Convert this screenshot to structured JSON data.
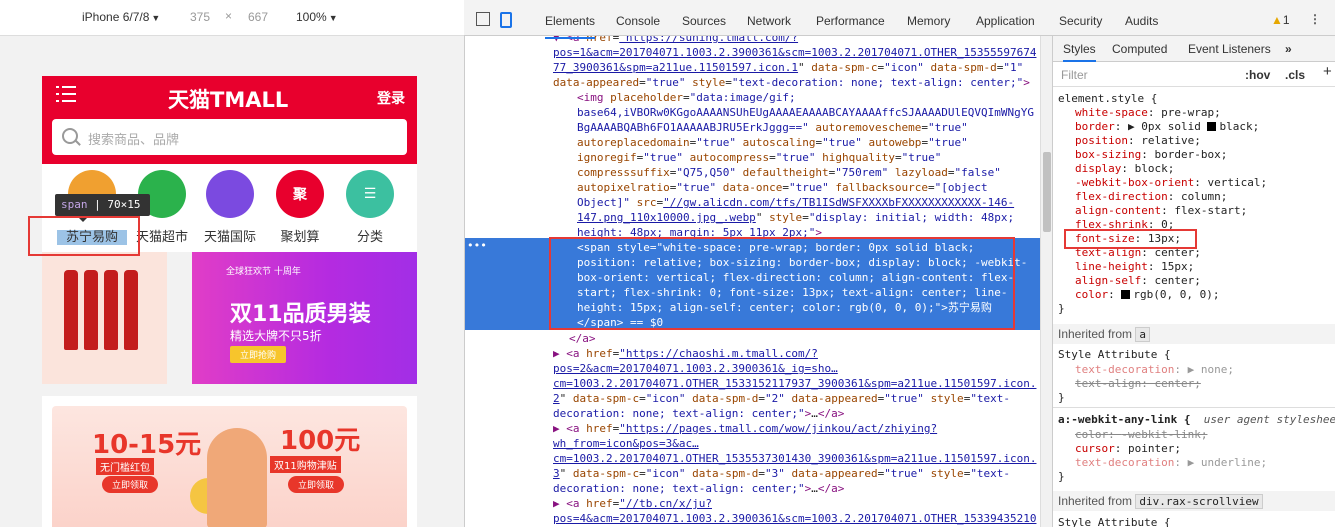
{
  "device_toolbar": {
    "device": "iPhone 6/7/8",
    "width": "375",
    "times": "×",
    "height": "667",
    "zoom": "100%"
  },
  "phone": {
    "brand": "天猫TMALL",
    "login": "登录",
    "search_placeholder": "搜索商品、品牌",
    "categories": [
      {
        "label": "苏宁易购",
        "icon": "suning-icon",
        "color": "#f0a030"
      },
      {
        "label": "天猫超市",
        "icon": "supermarket-icon",
        "color": "#2bb24c"
      },
      {
        "label": "天猫国际",
        "icon": "global-icon",
        "color": "#7b4ae0"
      },
      {
        "label": "聚划算",
        "icon": "ju-icon",
        "color": "#e8002d",
        "text": "聚"
      },
      {
        "label": "分类",
        "icon": "category-icon",
        "color": "#3cc0a0"
      }
    ],
    "tooltip": {
      "tag": "span",
      "size": "70×15"
    },
    "banner1": {
      "tag": "全球狂欢节 十周年",
      "title": "双11品质男装",
      "subtitle": "精选大牌不只5折",
      "button": "立即抢购"
    },
    "banner2": {
      "left_amount": "10-15元",
      "left_caption": "无门槛红包",
      "left_button": "立即领取",
      "right_amount": "100元",
      "right_caption": "双11购物津贴",
      "right_button": "立即领取"
    }
  },
  "devtools": {
    "tabs": [
      "Elements",
      "Console",
      "Sources",
      "Network",
      "Performance",
      "Memory",
      "Application",
      "Security",
      "Audits"
    ],
    "warnings": "1",
    "code_lines": [
      {
        "indent": 8,
        "tri": "▼",
        "html": "<a href=\"https://suning.tmall.com/?"
      },
      {
        "indent": 0,
        "html": "pos=1&acm=201704071.1003.2.3900361&scm=1003.2.201704071.OTHER_15355597674"
      },
      {
        "indent": 0,
        "html": "77_3900361&spm=a211ue.11501597.icon.1\" data-spm-c=\"icon\" data-spm-d=\"1\""
      },
      {
        "indent": 0,
        "html": "data-appeared=\"true\" style=\"text-decoration: none; text-align: center;\">"
      },
      {
        "indent": 24,
        "html": "<img placeholder=\"data:image/gif;"
      },
      {
        "indent": 24,
        "html": "base64,iVBORw0KGgoAAAANSUhEUgAAAAEAAAABCAYAAAAffcSJAAAADUlEQVQImWNgYG"
      },
      {
        "indent": 24,
        "html": "BgAAAABQABh6FO1AAAAABJRU5ErkJggg==\" autoremovescheme=\"true\""
      },
      {
        "indent": 24,
        "html": "autoreplacedomain=\"true\" autoscaling=\"true\" autowebp=\"true\""
      },
      {
        "indent": 24,
        "html": "ignoregif=\"true\" autocompress=\"true\" highquality=\"true\""
      },
      {
        "indent": 24,
        "html": "compresssuffix=\"Q75,Q50\" defaultheight=\"750rem\" lazyload=\"false\""
      },
      {
        "indent": 24,
        "html": "autopixelratio=\"true\" data-once=\"true\" fallbacksource=\"[object"
      },
      {
        "indent": 24,
        "html": "Object]\" src=\"//gw.alicdn.com/tfs/TB1ISdWSFXXXXbFXXXXXXXXXXXX-146-"
      },
      {
        "indent": 24,
        "html": "147.png_110x10000.jpg_.webp\" style=\"display: initial; width: 48px;"
      },
      {
        "indent": 24,
        "html": "height: 48px; margin: 5px 11px 2px;\">"
      }
    ],
    "selected_lines": [
      "<span style=\"white-space: pre-wrap; border: 0px solid black;",
      "position: relative; box-sizing: border-box; display: block; -webkit-",
      "box-orient: vertical; flex-direction: column; align-content: flex-",
      "start; flex-shrink: 0; font-size: 13px; text-align: center; line-",
      "height: 15px; align-self: center; color: rgb(0, 0, 0);\">苏宁易购",
      "</span> == $0"
    ],
    "after_lines": [
      {
        "indent": 16,
        "html": "</a>"
      },
      {
        "indent": 8,
        "tri": "▶",
        "html": "<a href=\"https://chaoshi.m.tmall.com/?"
      },
      {
        "indent": 0,
        "html": "pos=2&acm=201704071.1003.2.3900361&_ig=sho…"
      },
      {
        "indent": 0,
        "html": "cm=1003.2.201704071.OTHER_1533152117937_3900361&spm=a211ue.11501597.icon."
      },
      {
        "indent": 0,
        "html": "2\" data-spm-c=\"icon\" data-spm-d=\"2\" data-appeared=\"true\" style=\"text-"
      },
      {
        "indent": 0,
        "html": "decoration: none; text-align: center;\">…</a>"
      },
      {
        "indent": 8,
        "tri": "▶",
        "html": "<a href=\"https://pages.tmall.com/wow/jinkou/act/zhiying?"
      },
      {
        "indent": 0,
        "html": "wh_from=icon&pos=3&ac…"
      },
      {
        "indent": 0,
        "html": "cm=1003.2.201704071.OTHER_1535537301430_3900361&spm=a211ue.11501597.icon."
      },
      {
        "indent": 0,
        "html": "3\" data-spm-c=\"icon\" data-spm-d=\"3\" data-appeared=\"true\" style=\"text-"
      },
      {
        "indent": 0,
        "html": "decoration: none; text-align: center;\">…</a>"
      },
      {
        "indent": 8,
        "tri": "▶",
        "html": "<a href=\"//tb.cn/x/ju?"
      },
      {
        "indent": 0,
        "html": "pos=4&acm=201704071.1003.2.3900361&scm=1003.2.201704071.OTHER_15339435210"
      }
    ],
    "styles_tabs": [
      "Styles",
      "Computed",
      "Event Listeners"
    ],
    "filter_placeholder": "Filter",
    "hov": ":hov",
    "cls": ".cls",
    "plus": "+",
    "element_style_header": "element.style {",
    "props": [
      {
        "n": "white-space",
        "v": "pre-wrap;"
      },
      {
        "n": "border",
        "v": "▶ 0px solid ",
        "swatch": "black",
        "v2": "black;"
      },
      {
        "n": "position",
        "v": "relative;"
      },
      {
        "n": "box-sizing",
        "v": "border-box;"
      },
      {
        "n": "display",
        "v": "block;"
      },
      {
        "n": "-webkit-box-orient",
        "v": "vertical;"
      },
      {
        "n": "flex-direction",
        "v": "column;"
      },
      {
        "n": "align-content",
        "v": "flex-start;"
      },
      {
        "n": "flex-shrink",
        "v": "0;"
      },
      {
        "n": "font-size",
        "v": "13px;"
      },
      {
        "n": "text-align",
        "v": "center;"
      },
      {
        "n": "line-height",
        "v": "15px;"
      },
      {
        "n": "align-self",
        "v": "center;"
      },
      {
        "n": "color",
        "v": "",
        "swatch": "black",
        "v2": "rgb(0, 0, 0);"
      }
    ],
    "close_brace": "}",
    "inherited_from_label": "Inherited from",
    "inherited_a": "a",
    "style_attribute_header": "Style Attribute {",
    "inherited_props": [
      {
        "n": "text-decoration",
        "v": "▶ none;",
        "strike": false,
        "dim": true
      },
      {
        "n": "text-align",
        "v": "center;",
        "strike": true
      }
    ],
    "ua_header": "a:-webkit-any-link {",
    "ua_source": "user agent styleshee",
    "ua_props": [
      {
        "n": "color",
        "v": "-webkit-link;",
        "strike": true
      },
      {
        "n": "cursor",
        "v": "pointer;",
        "strike": false
      },
      {
        "n": "text-decoration",
        "v": "▶ underline;",
        "strike": false,
        "dim": true
      }
    ],
    "inherited_from2": "div.rax-scrollview",
    "style_attribute_header2": "Style Attribute {"
  }
}
